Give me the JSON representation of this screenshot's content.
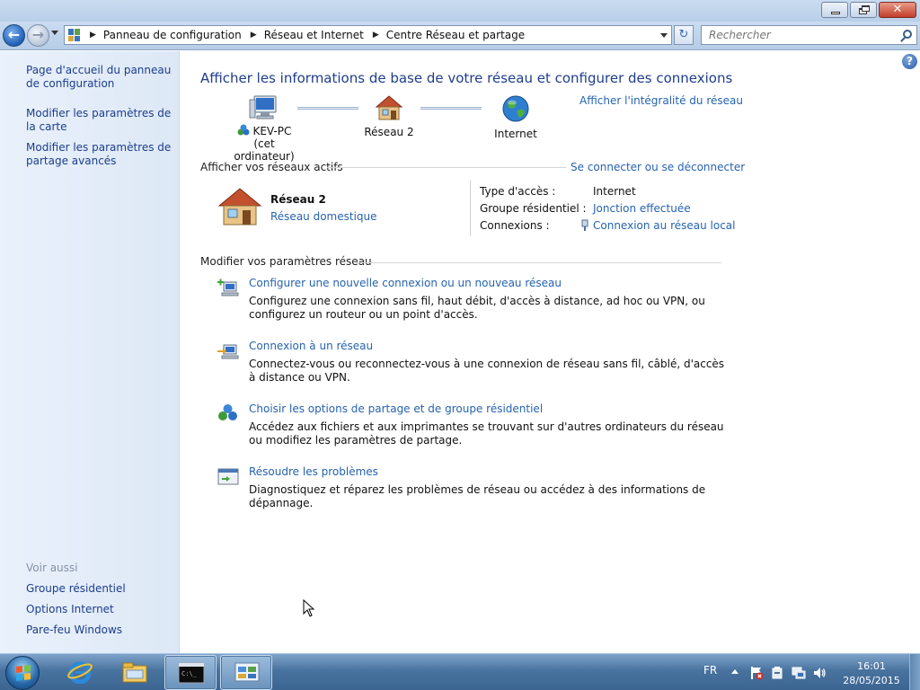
{
  "window": {
    "controls": {
      "minimize": "minimize",
      "maximize": "restore",
      "close": "✕"
    }
  },
  "navigation": {
    "back_icon": "back-arrow-icon",
    "forward_icon": "forward-arrow-icon",
    "breadcrumbs": [
      "Panneau de configuration",
      "Réseau et Internet",
      "Centre Réseau et partage"
    ],
    "search_placeholder": "Rechercher"
  },
  "sidebar": {
    "links": [
      "Page d'accueil du panneau de configuration",
      "Modifier les paramètres de la carte",
      "Modifier les paramètres de partage avancés"
    ],
    "see_also_label": "Voir aussi",
    "see_also_links": [
      "Groupe résidentiel",
      "Options Internet",
      "Pare-feu Windows"
    ]
  },
  "main": {
    "title": "Afficher les informations de base de votre réseau et configurer des connexions",
    "view_full_map_link": "Afficher l'intégralité du réseau",
    "network_map": {
      "computer_name": "KEV-PC",
      "computer_caption": "(cet ordinateur)",
      "network_name": "Réseau  2",
      "internet_label": "Internet"
    },
    "active_networks": {
      "header": "Afficher vos réseaux actifs",
      "connect_link": "Se connecter ou se déconnecter",
      "network_name": "Réseau  2",
      "network_type": "Réseau domestique",
      "properties": [
        {
          "label": "Type d'accès :",
          "value": "Internet",
          "is_link": false
        },
        {
          "label": "Groupe résidentiel :",
          "value": "Jonction effectuée",
          "is_link": true
        },
        {
          "label": "Connexions :",
          "value": "Connexion au réseau local",
          "is_link": true
        }
      ]
    },
    "change_settings": {
      "header": "Modifier vos paramètres réseau",
      "tasks": [
        {
          "title": "Configurer une nouvelle connexion ou un nouveau réseau",
          "description": "Configurez une connexion sans fil, haut débit, d'accès à distance, ad hoc ou VPN, ou configurez un routeur ou un point d'accès."
        },
        {
          "title": "Connexion à un réseau",
          "description": "Connectez-vous ou reconnectez-vous à une connexion de réseau sans fil, câblé, d'accès à distance ou VPN."
        },
        {
          "title": "Choisir les options de partage et de groupe résidentiel",
          "description": "Accédez aux fichiers et aux imprimantes se trouvant sur d'autres ordinateurs du réseau ou modifiez les paramètres de partage."
        },
        {
          "title": "Résoudre les problèmes",
          "description": "Diagnostiquez et réparez les problèmes de réseau ou accédez à des informations de dépannage."
        }
      ]
    }
  },
  "taskbar": {
    "apps": [
      "internet-explorer-icon",
      "windows-explorer-icon",
      "command-prompt-icon",
      "control-panel-icon"
    ],
    "language": "FR",
    "time": "16:01",
    "date": "28/05/2015"
  },
  "colors": {
    "link": "#2663b0",
    "title": "#1f3d8c",
    "sidebar_link": "#1d3d8d",
    "sidebar_bg": "#e4edf9",
    "taskbar": "#49739f"
  }
}
